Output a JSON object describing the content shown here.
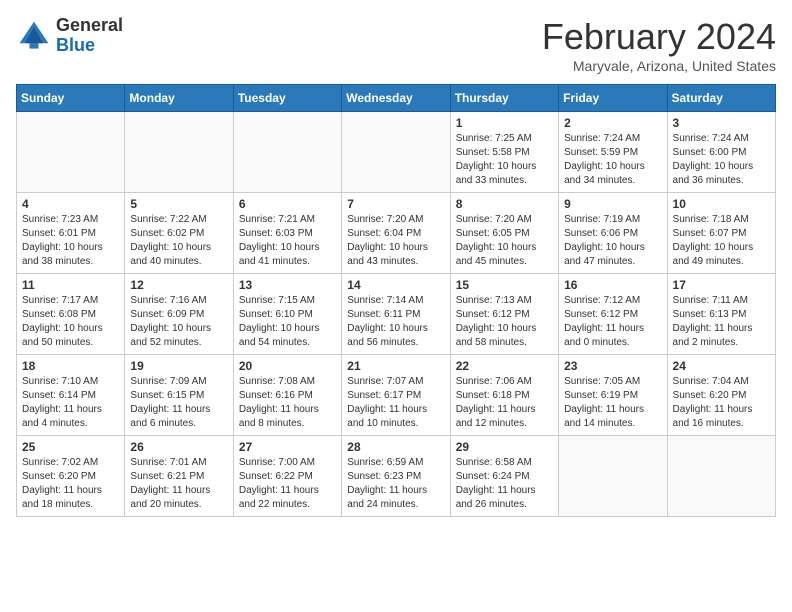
{
  "header": {
    "logo_line1": "General",
    "logo_line2": "Blue",
    "month": "February 2024",
    "location": "Maryvale, Arizona, United States"
  },
  "weekdays": [
    "Sunday",
    "Monday",
    "Tuesday",
    "Wednesday",
    "Thursday",
    "Friday",
    "Saturday"
  ],
  "weeks": [
    [
      {
        "day": "",
        "info": ""
      },
      {
        "day": "",
        "info": ""
      },
      {
        "day": "",
        "info": ""
      },
      {
        "day": "",
        "info": ""
      },
      {
        "day": "1",
        "info": "Sunrise: 7:25 AM\nSunset: 5:58 PM\nDaylight: 10 hours\nand 33 minutes."
      },
      {
        "day": "2",
        "info": "Sunrise: 7:24 AM\nSunset: 5:59 PM\nDaylight: 10 hours\nand 34 minutes."
      },
      {
        "day": "3",
        "info": "Sunrise: 7:24 AM\nSunset: 6:00 PM\nDaylight: 10 hours\nand 36 minutes."
      }
    ],
    [
      {
        "day": "4",
        "info": "Sunrise: 7:23 AM\nSunset: 6:01 PM\nDaylight: 10 hours\nand 38 minutes."
      },
      {
        "day": "5",
        "info": "Sunrise: 7:22 AM\nSunset: 6:02 PM\nDaylight: 10 hours\nand 40 minutes."
      },
      {
        "day": "6",
        "info": "Sunrise: 7:21 AM\nSunset: 6:03 PM\nDaylight: 10 hours\nand 41 minutes."
      },
      {
        "day": "7",
        "info": "Sunrise: 7:20 AM\nSunset: 6:04 PM\nDaylight: 10 hours\nand 43 minutes."
      },
      {
        "day": "8",
        "info": "Sunrise: 7:20 AM\nSunset: 6:05 PM\nDaylight: 10 hours\nand 45 minutes."
      },
      {
        "day": "9",
        "info": "Sunrise: 7:19 AM\nSunset: 6:06 PM\nDaylight: 10 hours\nand 47 minutes."
      },
      {
        "day": "10",
        "info": "Sunrise: 7:18 AM\nSunset: 6:07 PM\nDaylight: 10 hours\nand 49 minutes."
      }
    ],
    [
      {
        "day": "11",
        "info": "Sunrise: 7:17 AM\nSunset: 6:08 PM\nDaylight: 10 hours\nand 50 minutes."
      },
      {
        "day": "12",
        "info": "Sunrise: 7:16 AM\nSunset: 6:09 PM\nDaylight: 10 hours\nand 52 minutes."
      },
      {
        "day": "13",
        "info": "Sunrise: 7:15 AM\nSunset: 6:10 PM\nDaylight: 10 hours\nand 54 minutes."
      },
      {
        "day": "14",
        "info": "Sunrise: 7:14 AM\nSunset: 6:11 PM\nDaylight: 10 hours\nand 56 minutes."
      },
      {
        "day": "15",
        "info": "Sunrise: 7:13 AM\nSunset: 6:12 PM\nDaylight: 10 hours\nand 58 minutes."
      },
      {
        "day": "16",
        "info": "Sunrise: 7:12 AM\nSunset: 6:12 PM\nDaylight: 11 hours\nand 0 minutes."
      },
      {
        "day": "17",
        "info": "Sunrise: 7:11 AM\nSunset: 6:13 PM\nDaylight: 11 hours\nand 2 minutes."
      }
    ],
    [
      {
        "day": "18",
        "info": "Sunrise: 7:10 AM\nSunset: 6:14 PM\nDaylight: 11 hours\nand 4 minutes."
      },
      {
        "day": "19",
        "info": "Sunrise: 7:09 AM\nSunset: 6:15 PM\nDaylight: 11 hours\nand 6 minutes."
      },
      {
        "day": "20",
        "info": "Sunrise: 7:08 AM\nSunset: 6:16 PM\nDaylight: 11 hours\nand 8 minutes."
      },
      {
        "day": "21",
        "info": "Sunrise: 7:07 AM\nSunset: 6:17 PM\nDaylight: 11 hours\nand 10 minutes."
      },
      {
        "day": "22",
        "info": "Sunrise: 7:06 AM\nSunset: 6:18 PM\nDaylight: 11 hours\nand 12 minutes."
      },
      {
        "day": "23",
        "info": "Sunrise: 7:05 AM\nSunset: 6:19 PM\nDaylight: 11 hours\nand 14 minutes."
      },
      {
        "day": "24",
        "info": "Sunrise: 7:04 AM\nSunset: 6:20 PM\nDaylight: 11 hours\nand 16 minutes."
      }
    ],
    [
      {
        "day": "25",
        "info": "Sunrise: 7:02 AM\nSunset: 6:20 PM\nDaylight: 11 hours\nand 18 minutes."
      },
      {
        "day": "26",
        "info": "Sunrise: 7:01 AM\nSunset: 6:21 PM\nDaylight: 11 hours\nand 20 minutes."
      },
      {
        "day": "27",
        "info": "Sunrise: 7:00 AM\nSunset: 6:22 PM\nDaylight: 11 hours\nand 22 minutes."
      },
      {
        "day": "28",
        "info": "Sunrise: 6:59 AM\nSunset: 6:23 PM\nDaylight: 11 hours\nand 24 minutes."
      },
      {
        "day": "29",
        "info": "Sunrise: 6:58 AM\nSunset: 6:24 PM\nDaylight: 11 hours\nand 26 minutes."
      },
      {
        "day": "",
        "info": ""
      },
      {
        "day": "",
        "info": ""
      }
    ]
  ]
}
